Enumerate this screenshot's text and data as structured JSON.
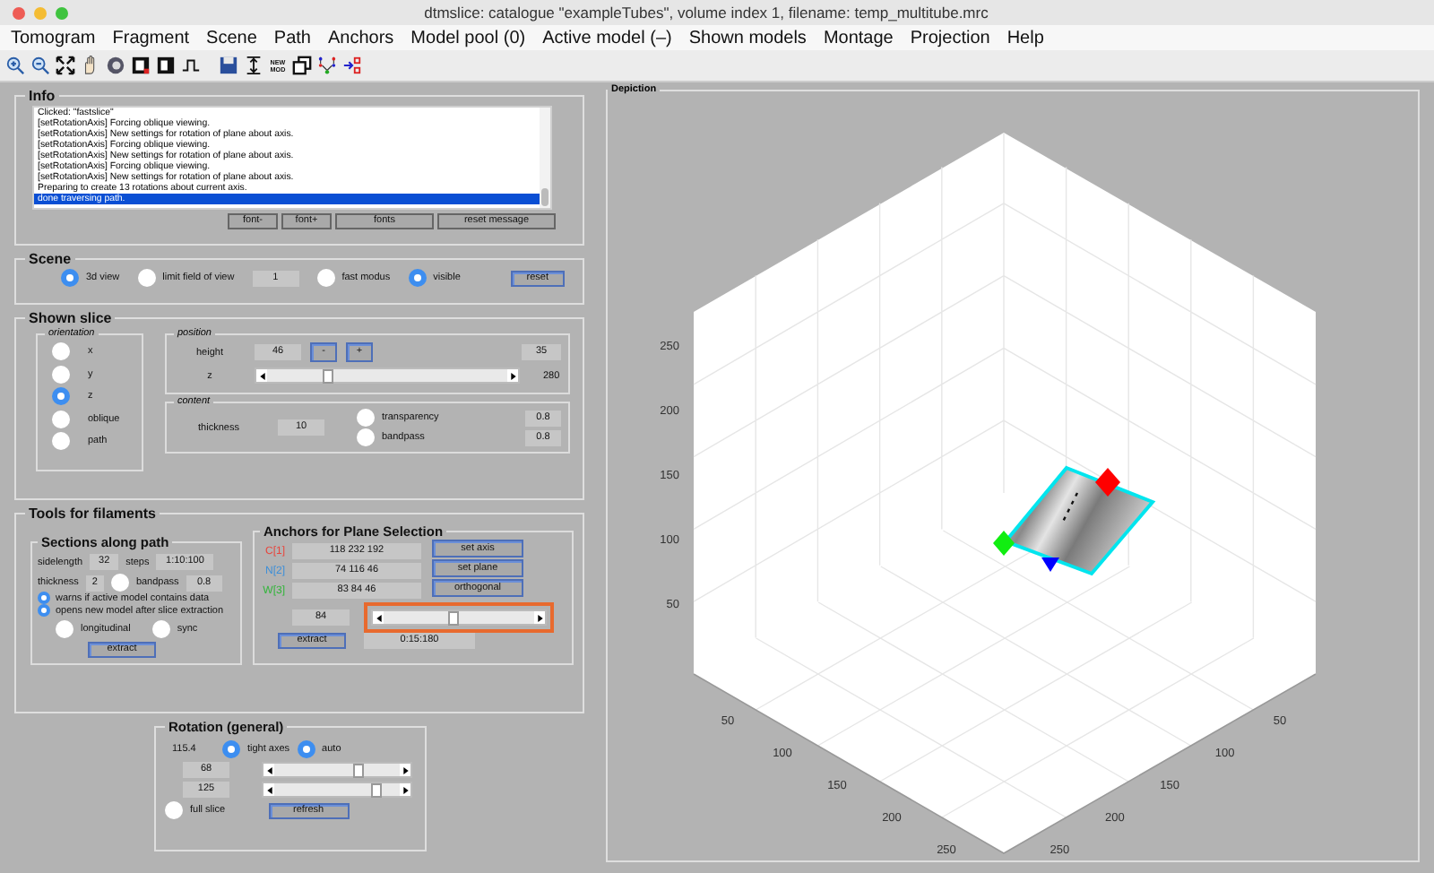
{
  "window": {
    "title": "dtmslice: catalogue \"exampleTubes\", volume index 1, filename: temp_multitube.mrc"
  },
  "menu": [
    "Tomogram",
    "Fragment",
    "Scene",
    "Path",
    "Anchors",
    "Model pool (0)",
    "Active model (–)",
    "Shown models",
    "Montage",
    "Projection",
    "Help"
  ],
  "toolbar": {
    "new_model_text": "NEW MOD"
  },
  "info": {
    "title": "Info",
    "log": [
      {
        "text": "Clicked: \"fastslice\"",
        "selected": false
      },
      {
        "text": "[setRotationAxis] Forcing oblique viewing.",
        "selected": false
      },
      {
        "text": "[setRotationAxis] New settings for rotation of plane about axis.",
        "selected": false
      },
      {
        "text": "[setRotationAxis] Forcing oblique viewing.",
        "selected": false
      },
      {
        "text": "[setRotationAxis] New settings for rotation of plane about axis.",
        "selected": false
      },
      {
        "text": "[setRotationAxis] Forcing oblique viewing.",
        "selected": false
      },
      {
        "text": "[setRotationAxis] New settings for rotation of plane about axis.",
        "selected": false
      },
      {
        "text": "Preparing to create 13 rotations about current axis.",
        "selected": false
      },
      {
        "text": "done traversing path.",
        "selected": true
      }
    ],
    "buttons": [
      "font-",
      "font+",
      "fonts",
      "reset message"
    ]
  },
  "scene": {
    "title": "Scene",
    "options": [
      {
        "kind": "radio",
        "label": "3d view",
        "checked": true
      },
      {
        "kind": "radio",
        "label": "limit field of view",
        "checked": false
      },
      {
        "kind": "field",
        "value": "1"
      },
      {
        "kind": "radio",
        "label": "fast modus",
        "checked": false
      },
      {
        "kind": "radio",
        "label": "visible",
        "checked": true
      }
    ],
    "reset_button": "reset"
  },
  "shown_slice": {
    "title": "Shown slice",
    "orientation": {
      "title": "orientation",
      "options": [
        {
          "label": "x",
          "selected": false
        },
        {
          "label": "y",
          "selected": false
        },
        {
          "label": "z",
          "selected": true
        },
        {
          "label": "oblique",
          "selected": false
        },
        {
          "label": "path",
          "selected": false
        }
      ]
    },
    "position": {
      "title": "position",
      "height_label": "height",
      "height_value": "46",
      "minus": "-",
      "plus": "+",
      "count": "35",
      "slider_label": "z",
      "level": 0.25,
      "slider_max": "280"
    },
    "content": {
      "title": "content",
      "thickness_label": "thickness",
      "thickness": "10",
      "toggles": [
        {
          "label": "transparency",
          "checked": false,
          "value": "0.8"
        },
        {
          "label": "bandpass",
          "checked": false,
          "value": "0.8"
        }
      ]
    }
  },
  "tools": {
    "title": "Tools for filaments",
    "sections": {
      "title": "Sections along path",
      "sidelength_label": "sidelength",
      "sidelength": "32",
      "steps_label": "steps",
      "steps": "1:10:100",
      "thickness_label": "thickness",
      "thickness": "2",
      "bandpass_label": "bandpass",
      "bandpass_checked": false,
      "bandpass": "0.8",
      "checks": [
        {
          "label": "warns if active model contains data",
          "checked": true
        },
        {
          "label": "opens new model after slice extraction",
          "checked": true
        }
      ],
      "modes": [
        {
          "label": "longitudinal",
          "checked": false
        },
        {
          "label": "sync",
          "checked": false
        }
      ],
      "extract": "extract"
    },
    "anchors": {
      "title": "Anchors for Plane Selection",
      "points": [
        {
          "label": "C[1]",
          "value": "118 232 192",
          "color": "#e8453c"
        },
        {
          "label": "N[2]",
          "value": "74 116 46",
          "color": "#3d8fd8"
        },
        {
          "label": "W[3]",
          "value": "83 84 46",
          "color": "#32b53a"
        }
      ],
      "buttons": [
        "set axis",
        "set plane",
        "orthogonal"
      ],
      "angle": "84",
      "level": 0.47,
      "extract": "extract",
      "range": "0:15:180"
    }
  },
  "rotation": {
    "title": "Rotation (general)",
    "value": "115.4",
    "options": [
      {
        "label": "tight axes",
        "checked": true
      },
      {
        "label": "auto",
        "checked": true
      }
    ],
    "sliders": [
      {
        "value": "68",
        "level": 0.67
      },
      {
        "value": "125",
        "level": 0.82
      }
    ],
    "full_slice": {
      "label": "full slice",
      "checked": false
    },
    "refresh": "refresh"
  },
  "depiction": {
    "title": "Depiction",
    "vertical_ticks": [
      "250",
      "200",
      "150",
      "100",
      "50"
    ],
    "left_ticks": [
      "50",
      "100",
      "150",
      "200",
      "250"
    ],
    "right_ticks": [
      "50",
      "100",
      "150",
      "200",
      "250"
    ]
  }
}
